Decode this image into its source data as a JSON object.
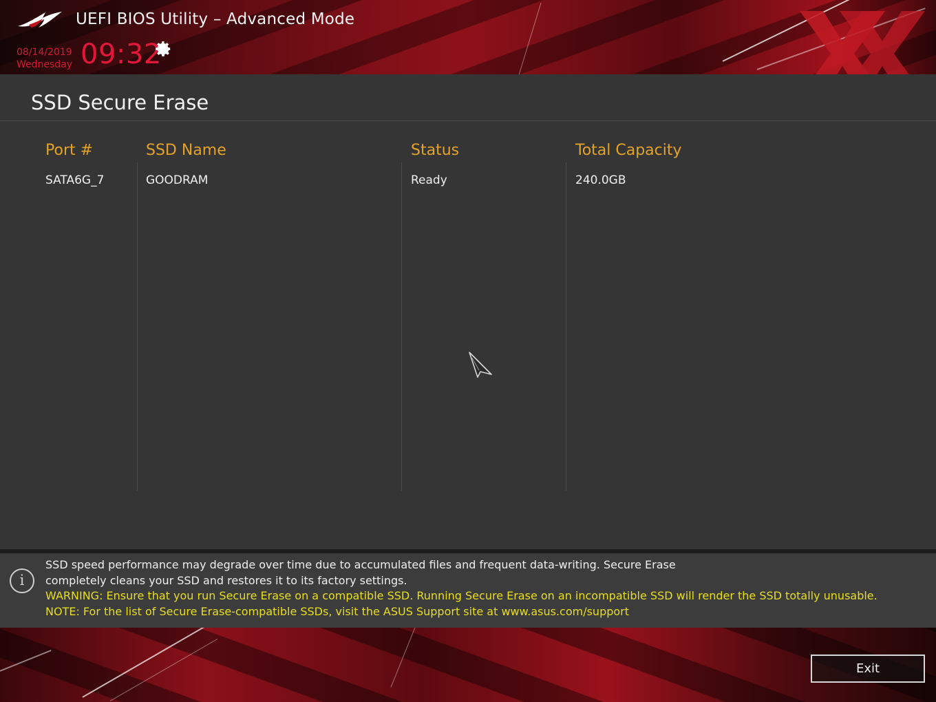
{
  "header": {
    "title": "UEFI BIOS Utility – Advanced Mode",
    "date": "08/14/2019",
    "weekday": "Wednesday",
    "time": "09:32",
    "settings_icon": "gear-icon",
    "logo_icon": "rog-eye-logo",
    "accent_color": "#e2173a"
  },
  "page": {
    "title": "SSD Secure Erase"
  },
  "table": {
    "columns": [
      "Port #",
      "SSD Name",
      "Status",
      "Total Capacity"
    ],
    "rows": [
      {
        "port": "SATA6G_7",
        "name": "GOODRAM",
        "status": "Ready",
        "capacity": "240.0GB"
      }
    ],
    "header_color": "#e3a32a"
  },
  "info": {
    "icon": "info-icon",
    "line1": "SSD speed performance may degrade over time due to accumulated files and frequent data-writing. Secure Erase",
    "line2": "completely cleans your SSD and restores it to its factory settings.",
    "warning": "WARNING: Ensure that you run Secure Erase on a compatible SSD. Running Secure Erase on an incompatible SSD will render the SSD totally unusable.",
    "note": "NOTE: For the list of Secure Erase-compatible SSDs, visit the ASUS Support site at www.asus.com/support",
    "warning_color": "#e8df1c"
  },
  "footer": {
    "exit_label": "Exit"
  }
}
